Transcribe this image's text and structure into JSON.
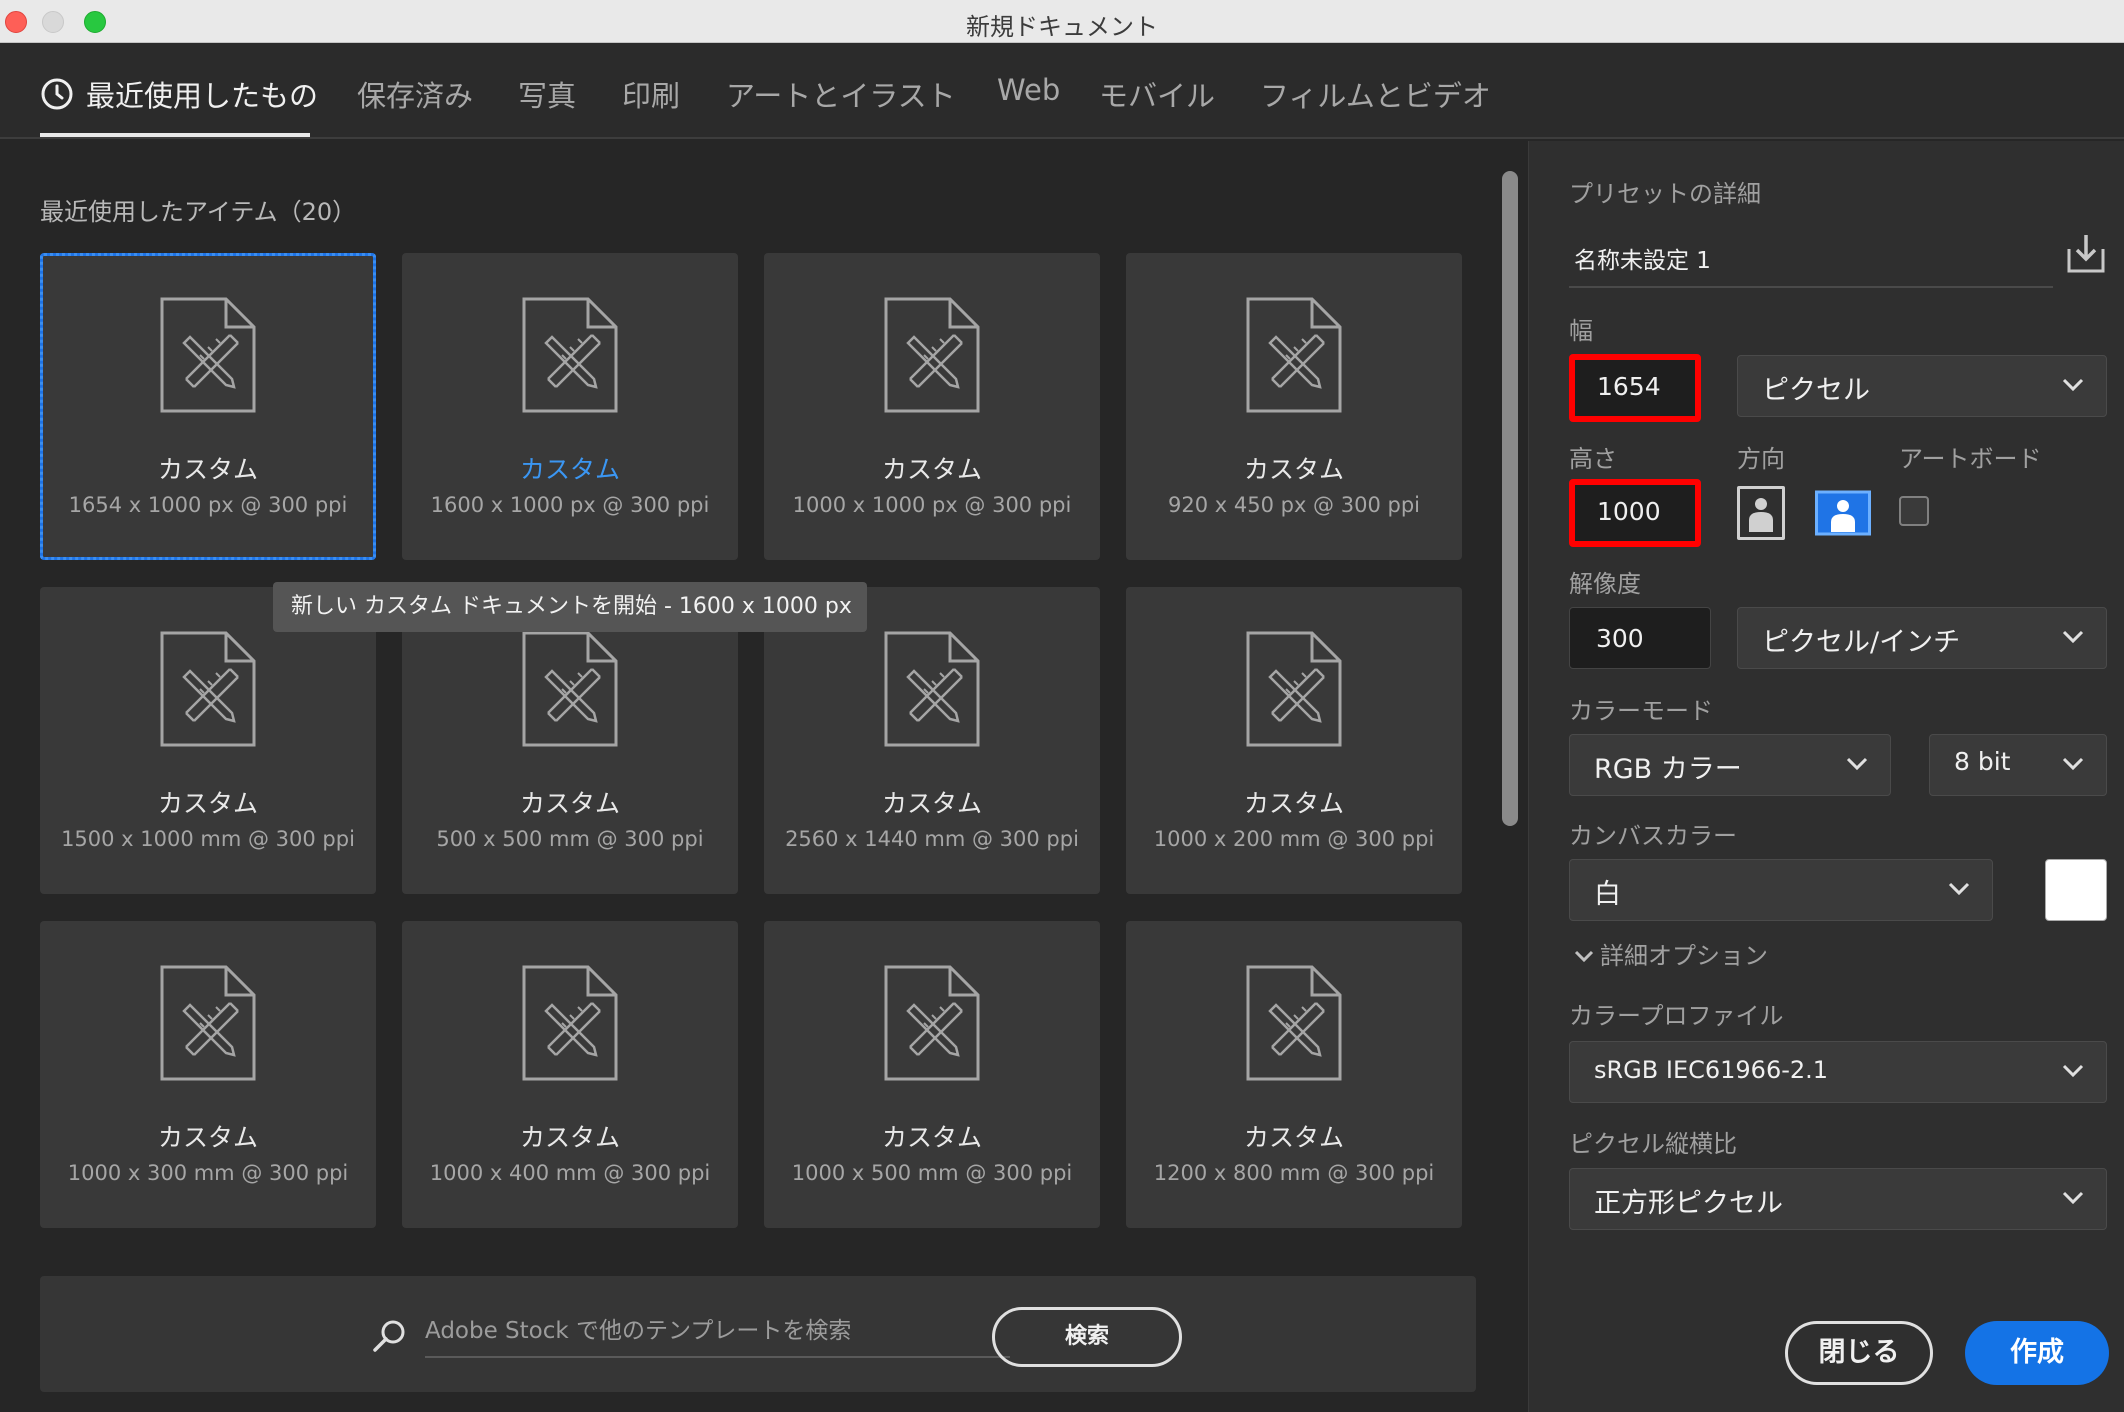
{
  "window": {
    "title": "新規ドキュメント"
  },
  "tabs": [
    {
      "label": "最近使用したもの",
      "active": true
    },
    {
      "label": "保存済み"
    },
    {
      "label": "写真"
    },
    {
      "label": "印刷"
    },
    {
      "label": "アートとイラスト"
    },
    {
      "label": "Web"
    },
    {
      "label": "モバイル"
    },
    {
      "label": "フィルムとビデオ"
    }
  ],
  "recent": {
    "title": "最近使用したアイテム（20）",
    "items": [
      {
        "name": "カスタム",
        "size": "1654 x 1000 px @ 300 ppi",
        "selected": true
      },
      {
        "name": "カスタム",
        "size": "1600 x 1000 px @ 300 ppi",
        "hovered": true
      },
      {
        "name": "カスタム",
        "size": "1000 x 1000 px @ 300 ppi"
      },
      {
        "name": "カスタム",
        "size": "920 x 450 px @ 300 ppi"
      },
      {
        "name": "カスタム",
        "size": "1500 x 1000 mm @ 300 ppi"
      },
      {
        "name": "カスタム",
        "size": "500 x 500 mm @ 300 ppi"
      },
      {
        "name": "カスタム",
        "size": "2560 x 1440 mm @ 300 ppi"
      },
      {
        "name": "カスタム",
        "size": "1000 x 200 mm @ 300 ppi"
      },
      {
        "name": "カスタム",
        "size": "1000 x 300 mm @ 300 ppi"
      },
      {
        "name": "カスタム",
        "size": "1000 x 400 mm @ 300 ppi"
      },
      {
        "name": "カスタム",
        "size": "1000 x 500 mm @ 300 ppi"
      },
      {
        "name": "カスタム",
        "size": "1200 x 800 mm @ 300 ppi"
      }
    ],
    "tooltip": "新しい カスタム ドキュメントを開始 - 1600 x 1000 px"
  },
  "stock": {
    "placeholder": "Adobe Stock で他のテンプレートを検索",
    "search_label": "検索"
  },
  "preset": {
    "header": "プリセットの詳細",
    "name": "名称未設定 1",
    "width_label": "幅",
    "width_value": "1654",
    "width_unit": "ピクセル",
    "height_label": "高さ",
    "height_value": "1000",
    "orientation_label": "方向",
    "artboard_label": "アートボード",
    "resolution_label": "解像度",
    "resolution_value": "300",
    "resolution_unit": "ピクセル/インチ",
    "color_mode_label": "カラーモード",
    "color_mode": "RGB カラー",
    "bit_depth": "8 bit",
    "canvas_color_label": "カンバスカラー",
    "canvas_color": "白",
    "advanced_label": "詳細オプション",
    "color_profile_label": "カラープロファイル",
    "color_profile": "sRGB IEC61966-2.1",
    "pixel_aspect_label": "ピクセル縦横比",
    "pixel_aspect": "正方形ピクセル"
  },
  "actions": {
    "close": "閉じる",
    "create": "作成"
  },
  "colors": {
    "accent": "#1473e6",
    "highlight_text": "#3b96f2",
    "annotation": "#ff0000"
  }
}
